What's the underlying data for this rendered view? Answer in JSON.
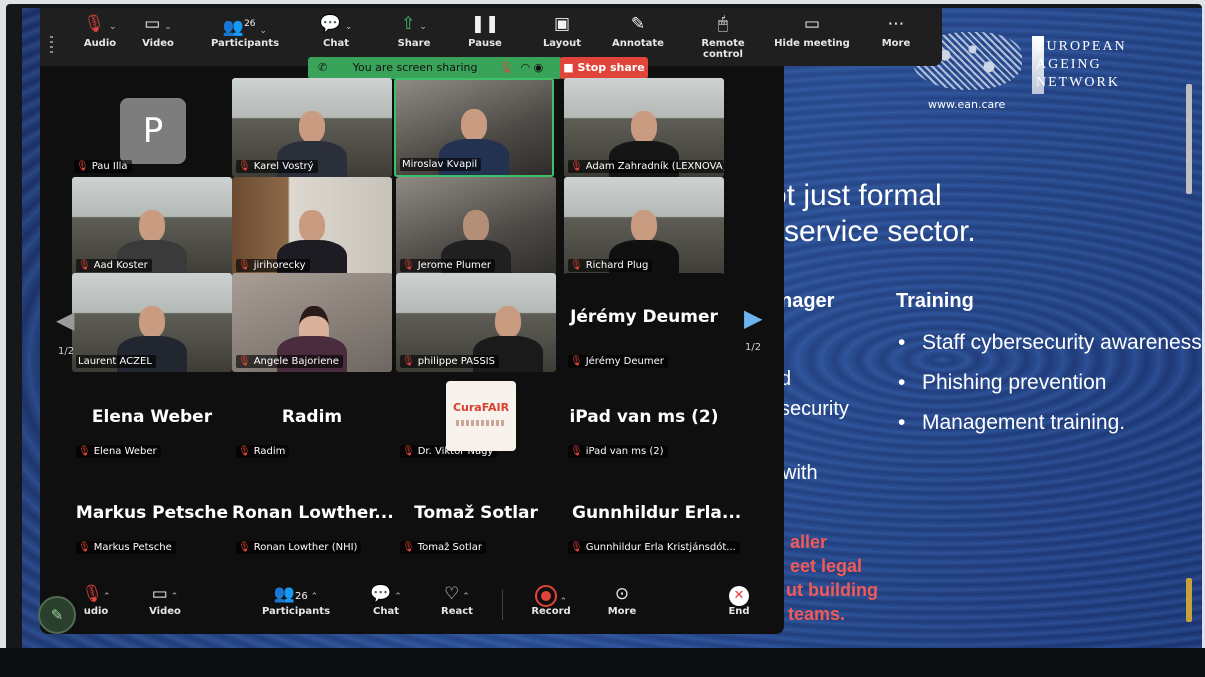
{
  "toolbar": {
    "audio": "Audio",
    "video": "Video",
    "participants": "Participants",
    "participant_count": "26",
    "chat": "Chat",
    "share": "Share",
    "pause": "Pause",
    "layout": "Layout",
    "annotate": "Annotate",
    "remote_control": "Remote control",
    "hide_meeting": "Hide meeting",
    "more": "More"
  },
  "share_banner": {
    "text": "You are screen sharing",
    "stop_label": "Stop share"
  },
  "gallery": {
    "page_indicator": "1/2",
    "tiles": [
      {
        "name": "Pau Illa",
        "avatar_letter": "P"
      },
      {
        "name": "Karel Vostrý"
      },
      {
        "name": "Miroslav Kvapil"
      },
      {
        "name": "Adam Zahradník (LEXNOVA)"
      },
      {
        "name": "Aad Koster"
      },
      {
        "name": "jirihorecky"
      },
      {
        "name": "Jerome Plumer"
      },
      {
        "name": "Richard Plug"
      },
      {
        "name": "Laurent ACZEL"
      },
      {
        "name": "Angele Bajoriene"
      },
      {
        "name": "philippe PASSIS"
      },
      {
        "name": "Jérémy Deumer",
        "display": "Jérémy Deumer"
      },
      {
        "name": "Elena Weber",
        "display": "Elena Weber"
      },
      {
        "name": "Radim",
        "display": "Radim"
      },
      {
        "name": "Dr. Viktor Nagy",
        "logo": "CuraFAIR"
      },
      {
        "name": "iPad van ms (2)",
        "display": "iPad van ms (2)"
      },
      {
        "name": "Markus Petsche",
        "display": "Markus Petsche"
      },
      {
        "name": "Ronan Lowther (NHI)",
        "display": "Ronan  Lowther..."
      },
      {
        "name": "Tomaž Sotlar",
        "display": "Tomaž Sotlar"
      },
      {
        "name": "Gunnhildur Erla Kristjánsdót...",
        "display": "Gunnhildur  Erla..."
      }
    ]
  },
  "bottom_toolbar": {
    "audio": "udio",
    "video": "Video",
    "participants": "Participants",
    "participant_count": "26",
    "chat": "Chat",
    "react": "React",
    "record": "Record",
    "more": "More",
    "end": "End"
  },
  "slide": {
    "title_lines": [
      "ot just formal",
      " service sector."
    ],
    "column_heads": [
      "nager",
      "Training"
    ],
    "left_fragments": [
      "d",
      "security",
      "with"
    ],
    "red_fragments": [
      "aller",
      "eet legal",
      "ut building",
      "teams."
    ],
    "training_bullets": [
      "Staff cybersecurity awareness",
      "Phishing prevention",
      "Management training."
    ],
    "logo": {
      "url": "www.ean.care",
      "name_lines": [
        "EUROPEAN",
        "AGEING",
        "NETWORK"
      ]
    }
  }
}
